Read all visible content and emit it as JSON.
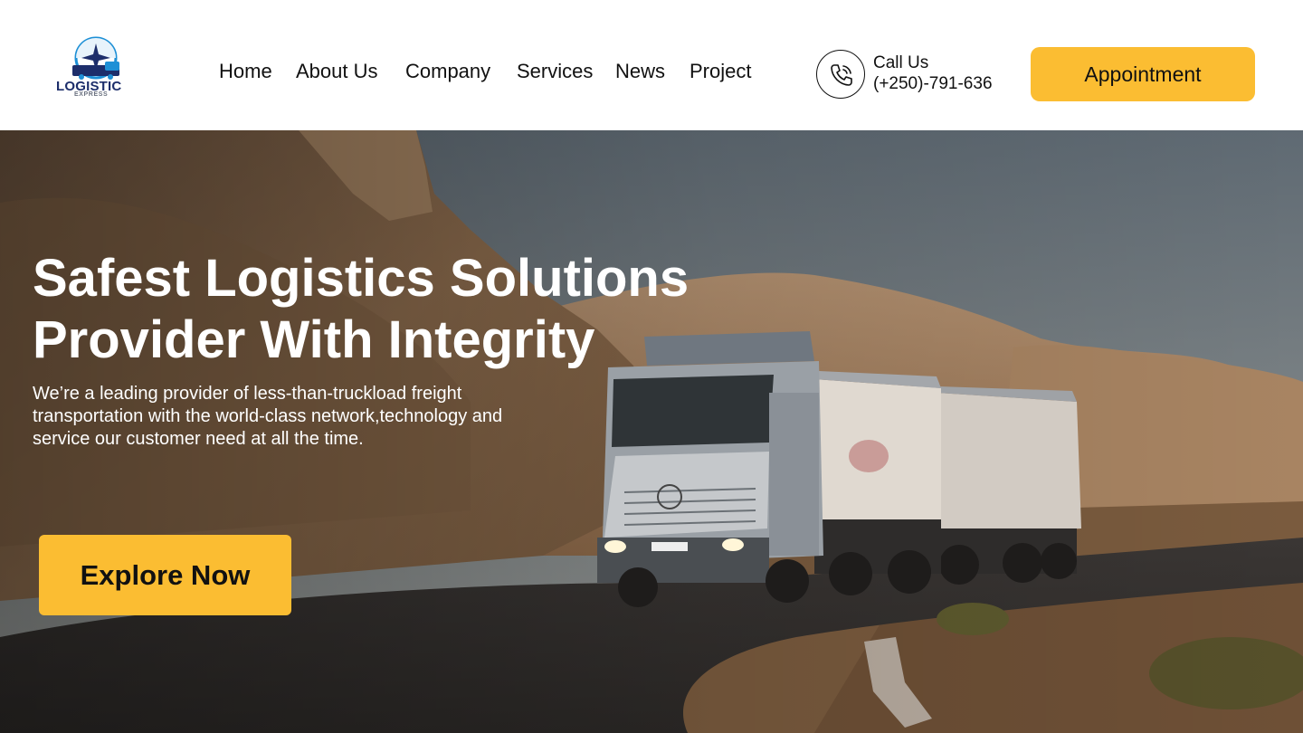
{
  "brand": {
    "name": "LOGISTIC",
    "tagline": "EXPRESS",
    "accent_color": "#fbbd32",
    "logo_color": "#1d2e6b"
  },
  "nav": {
    "items": [
      "Home",
      "About Us",
      "Company",
      "Services",
      "News",
      "Project"
    ]
  },
  "contact": {
    "label": "Call Us",
    "phone": "(+250)-791-636",
    "icon": "phone-icon"
  },
  "header": {
    "appointment_label": "Appointment"
  },
  "hero": {
    "title_line1": "Safest Logistics Solutions",
    "title_line2": "Provider With Integrity",
    "desc_line1": "We’re  a leading provider of less-than-truckload freight",
    "desc_line2": "transportation with the world-class network,technology and",
    "desc_line3": "service our customer need at all the time.",
    "cta_label": "Explore Now",
    "image": "truck-on-desert-road-photo"
  }
}
